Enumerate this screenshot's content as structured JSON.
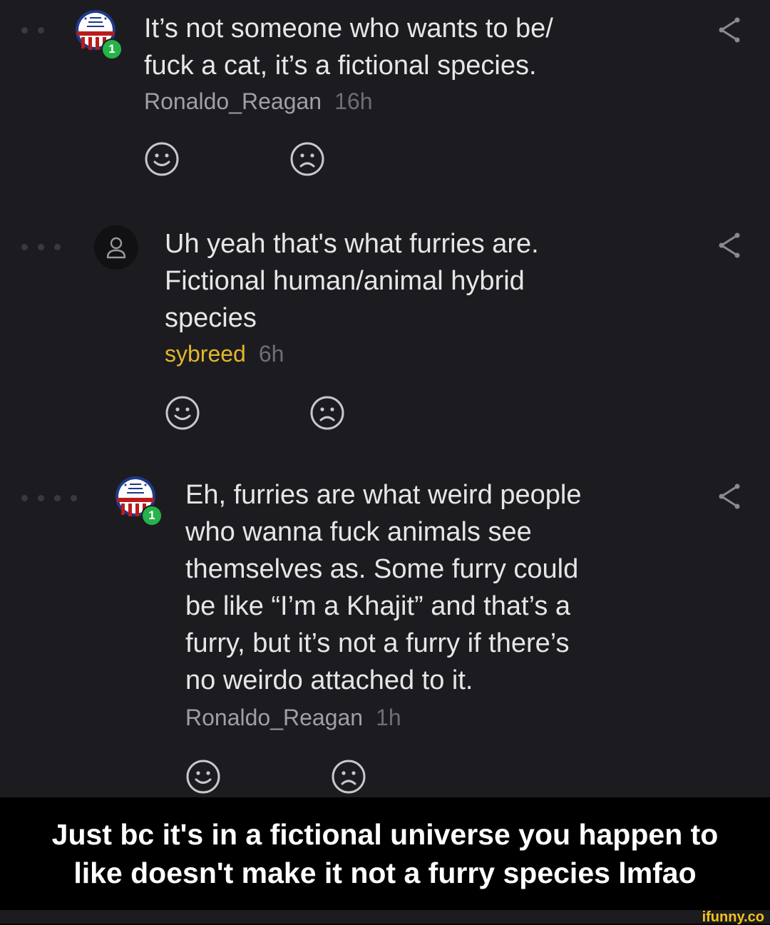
{
  "comments": [
    {
      "text": "It’s not someone who wants to be/\nfuck a cat, it’s a fictional species.",
      "author": "Ronaldo_Reagan",
      "time": "16h",
      "badge": "1",
      "avatar_icon": "reagan-campaign-button-icon"
    },
    {
      "text": "Uh yeah that's what furries are.\nFictional human/animal hybrid\nspecies",
      "author": "sybreed",
      "time": "6h",
      "avatar_icon": "default-user-icon"
    },
    {
      "text": "Eh, furries are what weird people\nwho wanna fuck animals see\nthemselves as. Some furry could\nbe like “I’m a Khajit” and that’s a\nfurry, but it’s not a furry if there’s\nno weirdo attached to it.",
      "author": "Ronaldo_Reagan",
      "time": "1h",
      "badge": "1",
      "avatar_icon": "reagan-campaign-button-icon"
    }
  ],
  "caption": {
    "line1": "Just bc it's in a fictional universe you happen to",
    "line2": "like doesn't make it not a furry species lmfao"
  },
  "watermark": "ifunny.co",
  "colors": {
    "background": "#1c1c20",
    "text": "#e6e6e6",
    "author_gold": "#e3b72a",
    "badge_green": "#27b24a"
  }
}
